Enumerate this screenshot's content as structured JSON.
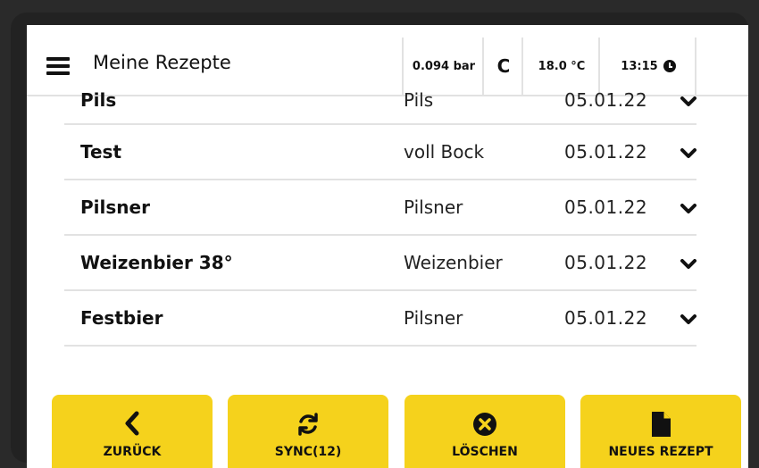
{
  "header": {
    "title": "Meine Rezepte",
    "menu_icon": "hamburger-menu-icon",
    "pressure": "0.094 bar",
    "mode": "C",
    "temperature": "18.0 °C",
    "time": "13:15",
    "time_icon": "clock-icon"
  },
  "recipes": [
    {
      "name": "Pils",
      "style": "Pils",
      "date": "05.01.22"
    },
    {
      "name": "Test",
      "style": "voll Bock",
      "date": "05.01.22"
    },
    {
      "name": "Pilsner",
      "style": "Pilsner",
      "date": "05.01.22"
    },
    {
      "name": "Weizenbier 38°",
      "style": "Weizenbier",
      "date": "05.01.22"
    },
    {
      "name": "Festbier",
      "style": "Pilsner",
      "date": "05.01.22"
    }
  ],
  "footer": {
    "back": {
      "label": "ZURÜCK",
      "icon": "chevron-left-icon"
    },
    "sync": {
      "label": "SYNC(12)",
      "icon": "sync-icon"
    },
    "delete": {
      "label": "LÖSCHEN",
      "icon": "close-circle-icon"
    },
    "new": {
      "label": "NEUES REZEPT",
      "icon": "file-icon"
    }
  },
  "colors": {
    "accent": "#f5d21c",
    "text": "#111111",
    "divider": "#e2e2e2"
  }
}
